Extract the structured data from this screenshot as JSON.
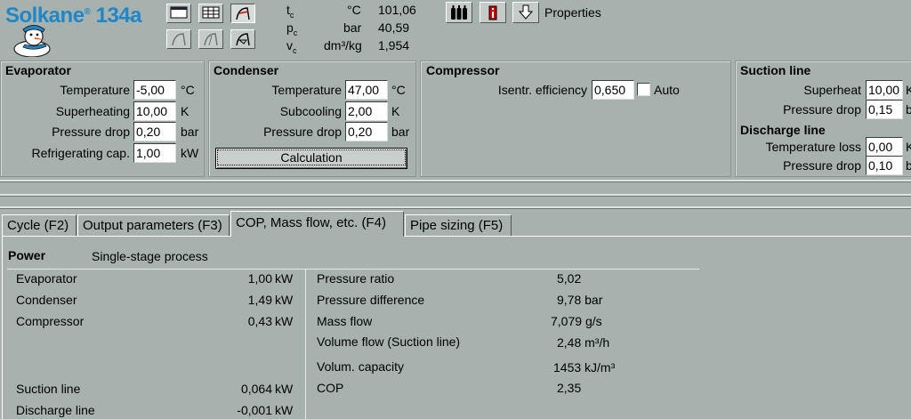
{
  "app": {
    "logo": "Solkane",
    "reg": "®",
    "model": "134a"
  },
  "toolbar": {
    "properties_label": "Properties"
  },
  "header_values": {
    "rows": [
      {
        "symbol": "t",
        "sub": "c",
        "unit": "°C",
        "value": "101,06"
      },
      {
        "symbol": "p",
        "sub": "c",
        "unit": "bar",
        "value": "40,59"
      },
      {
        "symbol": "v",
        "sub": "c",
        "unit": "dm³/kg",
        "value": "1,954"
      }
    ]
  },
  "evaporator": {
    "title": "Evaporator",
    "temperature": {
      "label": "Temperature",
      "value": "-5,00",
      "unit": "°C"
    },
    "superheating": {
      "label": "Superheating",
      "value": "10,00",
      "unit": "K"
    },
    "pressure_drop": {
      "label": "Pressure drop",
      "value": "0,20",
      "unit": "bar"
    },
    "refrigerating_cap": {
      "label": "Refrigerating cap.",
      "value": "1,00",
      "unit": "kW"
    }
  },
  "condenser": {
    "title": "Condenser",
    "temperature": {
      "label": "Temperature",
      "value": "47,00",
      "unit": "°C"
    },
    "subcooling": {
      "label": "Subcooling",
      "value": "2,00",
      "unit": "K"
    },
    "pressure_drop": {
      "label": "Pressure drop",
      "value": "0,20",
      "unit": "bar"
    },
    "calc_label": "Calculation"
  },
  "compressor": {
    "title": "Compressor",
    "isentr": {
      "label": "Isentr. efficiency",
      "value": "0,650"
    },
    "auto_label": "Auto"
  },
  "suction_line": {
    "title": "Suction line",
    "superheat": {
      "label": "Superheat",
      "value": "10,00",
      "unit": "K"
    },
    "pressure_drop": {
      "label": "Pressure drop",
      "value": "0,15",
      "unit": "bar"
    }
  },
  "discharge_line": {
    "title": "Discharge line",
    "temperature_loss": {
      "label": "Temperature loss",
      "value": "0,00",
      "unit": "K"
    },
    "pressure_drop": {
      "label": "Pressure drop",
      "value": "0,10",
      "unit": "bar"
    }
  },
  "tabs": [
    {
      "label": "Cycle (F2)"
    },
    {
      "label": "Output parameters (F3)"
    },
    {
      "label": "COP, Mass flow, etc. (F4)",
      "active": true
    },
    {
      "label": "Pipe sizing (F5)"
    }
  ],
  "results": {
    "power_title": "Power",
    "process": "Single-stage process",
    "left": [
      {
        "label": "Evaporator",
        "value": "1,00",
        "unit": "kW"
      },
      {
        "label": "Condenser",
        "value": "1,49",
        "unit": "kW"
      },
      {
        "label": "Compressor",
        "value": "0,43",
        "unit": "kW"
      },
      {
        "label": "Suction line",
        "value": "0,064",
        "unit": "kW"
      },
      {
        "label": "Discharge line",
        "value": "-0,001",
        "unit": "kW"
      }
    ],
    "right": [
      {
        "label": "Pressure ratio",
        "value": "5,02",
        "unit": ""
      },
      {
        "label": "Pressure difference",
        "value": "9,78",
        "unit": "bar"
      },
      {
        "label": "Mass flow",
        "value": "7,079",
        "unit": "g/s"
      },
      {
        "label": "Volume flow (Suction line)",
        "value": "2,48",
        "unit": "m³/h"
      },
      {
        "label": "Volum. capacity",
        "value": "1453",
        "unit": "kJ/m³"
      },
      {
        "label": "COP",
        "value": "2,35",
        "unit": ""
      }
    ]
  }
}
